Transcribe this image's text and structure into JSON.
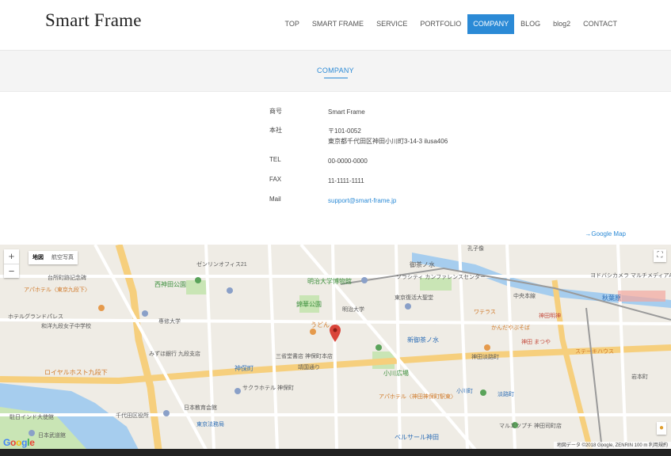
{
  "header": {
    "logo": "Smart Frame",
    "nav": [
      {
        "label": "TOP"
      },
      {
        "label": "SMART FRAME"
      },
      {
        "label": "SERVICE"
      },
      {
        "label": "PORTFOLIO"
      },
      {
        "label": "COMPANY",
        "active": true
      },
      {
        "label": "BLOG"
      },
      {
        "label": "blog2"
      },
      {
        "label": "CONTACT"
      }
    ]
  },
  "page": {
    "title": "COMPANY"
  },
  "company": {
    "name_label": "商号",
    "name_value": "Smart Frame",
    "address_label": "本社",
    "address_postal": "〒101-0052",
    "address_line": "東京都千代田区神田小川町3-14-3 ilusa406",
    "tel_label": "TEL",
    "tel_value": "00-0000-0000",
    "fax_label": "FAX",
    "fax_value": "11-1111-1111",
    "mail_label": "Mail",
    "mail_value": "support@smart-frame.jp"
  },
  "google_map_link": "→Google Map",
  "map": {
    "zoom_in": "+",
    "zoom_out": "−",
    "type_map": "地図",
    "type_satellite": "航空写真",
    "fullscreen_icon": "⛶",
    "attribution": "地図データ ©2018 Google, ZENRIN   100 m   利用規約",
    "google_logo": "Google",
    "labels": {
      "l1": "ゼンリンオフィス21",
      "l2": "台所町跡記念碑",
      "l3": "アパホテル〈東京九段下〉",
      "l4": "西神田公園",
      "l5": "明治大学博物館",
      "l6": "錦華公園",
      "l7": "明治大学",
      "l8": "東京復活大聖堂",
      "l9": "ソラシティ カンファレンスセンター",
      "l10": "御茶ノ水",
      "l11": "孔子像",
      "l12": "ヨドバシカメラ マルチメディアAkiba",
      "l13": "秋葉原",
      "l14": "ホテルグランドパレス",
      "l15": "専修大学",
      "l16": "みずほ銀行 九段支店",
      "l17": "うどん",
      "l18": "新御茶ノ水",
      "l19": "神田 まつや",
      "l20": "かんだやぶそば",
      "l21": "ワテラス",
      "l22": "神田淡路町",
      "l23": "三省堂書店 神保町本店",
      "l24": "神保町",
      "l25": "小川広場",
      "l26": "ロイヤルホスト九段下",
      "l27": "サクラホテル 神保町",
      "l28": "アパホテル〈神田神保町駅東〉",
      "l29": "小川町",
      "l30": "淡路町",
      "l31": "日本教育会館",
      "l32": "東京法務局",
      "l33": "千代田区役所",
      "l34": "駐日インド大使館",
      "l35": "日本武道館",
      "l36": "ベルサール神田",
      "l37": "マルエツプチ 神田司町店",
      "l38": "神田明神",
      "l39": "ステーキハウス",
      "l40": "岩本町",
      "l41": "和洋九段女子中学校",
      "l42": "靖国通り",
      "l43": "中央本線"
    }
  },
  "colors": {
    "accent": "#2b8ad6",
    "pin": "#d9453a",
    "park": "#c8e6b4",
    "water": "#9fc9ec",
    "road_major": "#f8d48a"
  }
}
